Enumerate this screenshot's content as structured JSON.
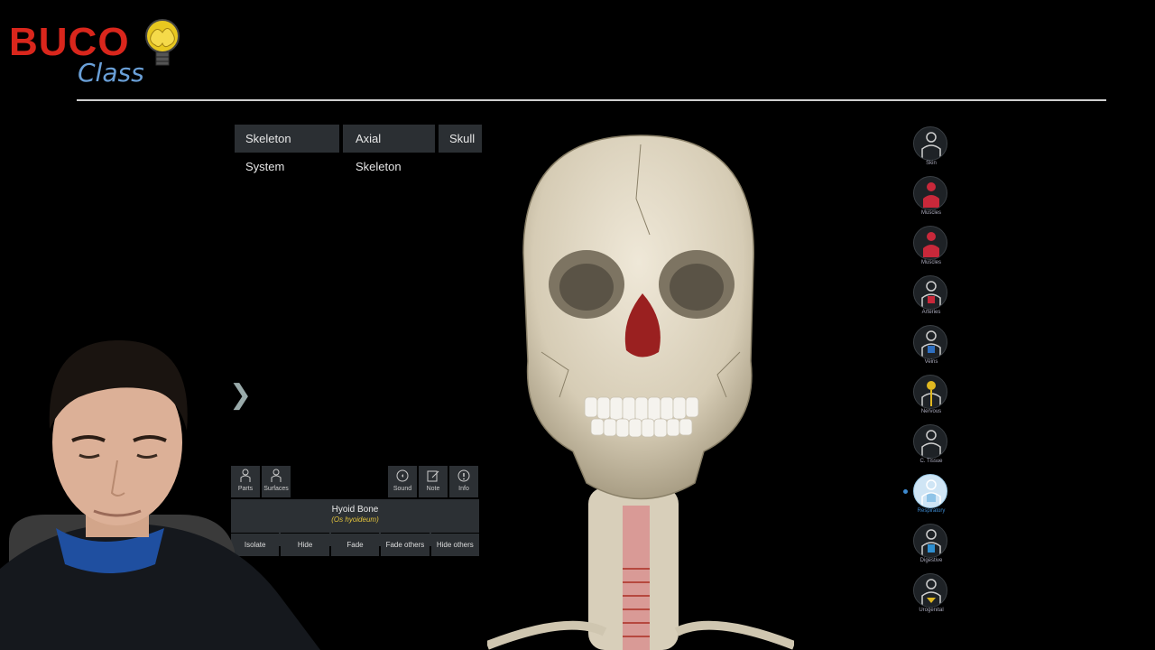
{
  "logo": {
    "word1": "BUCO",
    "word2": "Class"
  },
  "breadcrumb": [
    "Skeleton System",
    "Axial Skeleton",
    "Skull"
  ],
  "tools_left": [
    {
      "icon": "parts-icon",
      "label": "Parts"
    },
    {
      "icon": "surfaces-icon",
      "label": "Surfaces"
    }
  ],
  "tools_right": [
    {
      "icon": "sound-icon",
      "label": "Sound"
    },
    {
      "icon": "note-icon",
      "label": "Note"
    },
    {
      "icon": "info-icon",
      "label": "Info"
    }
  ],
  "selection": {
    "name": "Hyoid Bone",
    "latin": "(Os hyoideum)"
  },
  "actions": [
    "Isolate",
    "Hide",
    "Fade",
    "Fade others",
    "Hide others"
  ],
  "systems": [
    {
      "label": "Skin",
      "color": "#8a8f94"
    },
    {
      "label": "Muscles",
      "color": "#c8283a"
    },
    {
      "label": "Muscles",
      "color": "#c8283a"
    },
    {
      "label": "Arteries",
      "color": "#c8283a"
    },
    {
      "label": "Veins",
      "color": "#2f6fc0"
    },
    {
      "label": "Nervous",
      "color": "#e0b820"
    },
    {
      "label": "C. Tissue",
      "color": "#8a8f94"
    },
    {
      "label": "Respiratory",
      "color": "#8fc4e8"
    },
    {
      "label": "Digestive",
      "color": "#2f8fd0"
    },
    {
      "label": "Urogenital",
      "color": "#e0b820"
    }
  ],
  "colors": {
    "accent": "#3d8ad0",
    "highlight_bone": "#9a2020",
    "logo_red": "#d9261c",
    "logo_blue": "#6aa0d8"
  }
}
